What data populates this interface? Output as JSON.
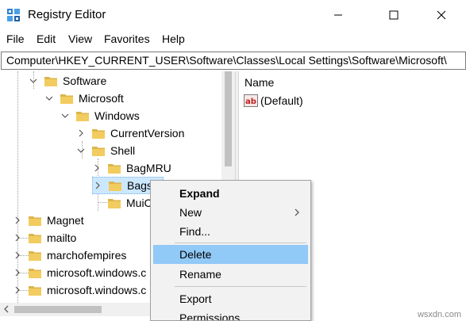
{
  "window": {
    "title": "Registry Editor",
    "controls": [
      "minimize-icon",
      "maximize-icon",
      "close-icon"
    ]
  },
  "menu": [
    "File",
    "Edit",
    "View",
    "Favorites",
    "Help"
  ],
  "address": "Computer\\HKEY_CURRENT_USER\\Software\\Classes\\Local Settings\\Software\\Microsoft\\",
  "tree": [
    {
      "label": "Software",
      "expander": "expanded"
    },
    {
      "label": "Microsoft",
      "expander": "expanded"
    },
    {
      "label": "Windows",
      "expander": "expanded"
    },
    {
      "label": "CurrentVersion",
      "expander": "collapsed"
    },
    {
      "label": "Shell",
      "expander": "expanded"
    },
    {
      "label": "BagMRU",
      "expander": "collapsed"
    },
    {
      "label": "Bags",
      "expander": "collapsed"
    },
    {
      "label": "MuiC",
      "expander": "none"
    },
    {
      "label": "Magnet",
      "expander": "collapsed"
    },
    {
      "label": "mailto",
      "expander": "collapsed"
    },
    {
      "label": "marchofempires",
      "expander": "collapsed"
    },
    {
      "label": "microsoft.windows.c",
      "expander": "collapsed"
    },
    {
      "label": "microsoft.windows.c",
      "expander": "collapsed"
    }
  ],
  "values_pane": {
    "column_name": "Name",
    "rows": [
      {
        "name": "(Default)",
        "icon": "string-value-icon"
      }
    ]
  },
  "context_menu": [
    {
      "label": "Expand",
      "bold": true
    },
    {
      "label": "New",
      "submenu": true
    },
    {
      "label": "Find..."
    },
    {
      "label": "Delete",
      "highlighted": true
    },
    {
      "label": "Rename"
    },
    {
      "label": "Export"
    },
    {
      "label": "Permissions..."
    }
  ],
  "watermark": "wsxdn.com",
  "colors": {
    "folder": "#dcb54a",
    "selection": "#cce8ff",
    "menu_highlight": "#91c9f7",
    "menu_bg": "#f2f2f2"
  }
}
